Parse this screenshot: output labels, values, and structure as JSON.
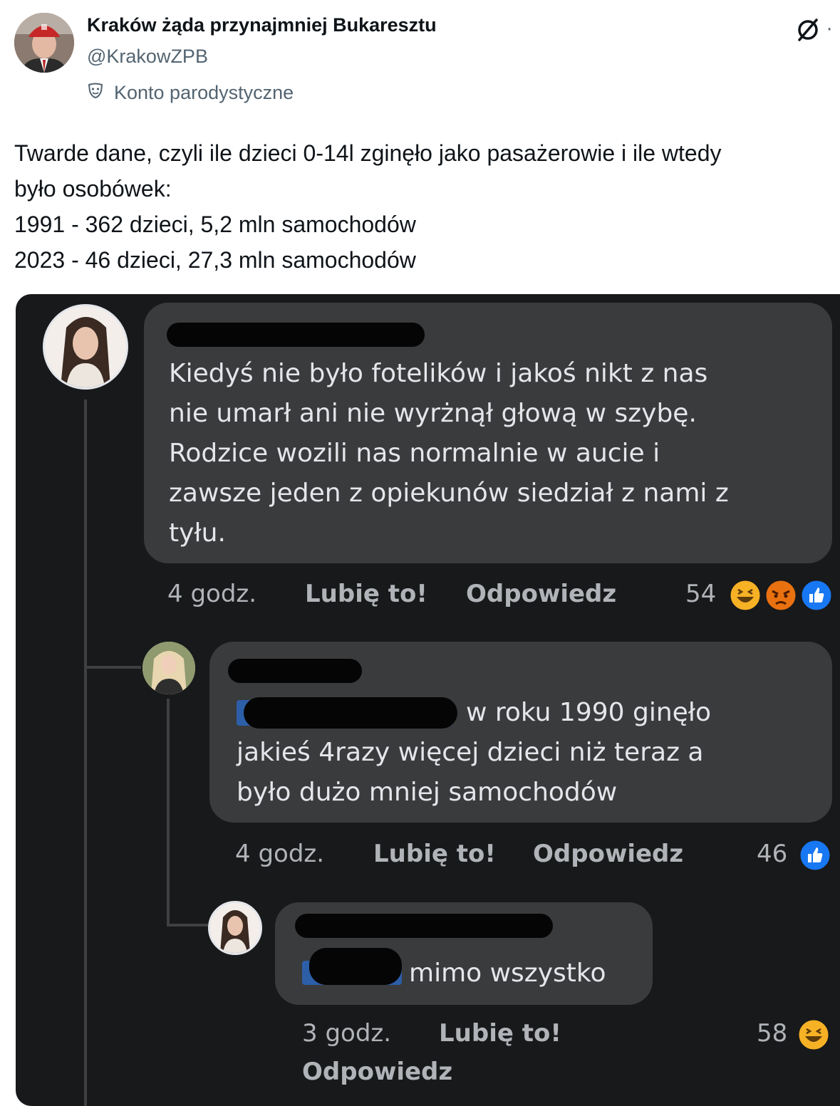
{
  "tweet": {
    "author_name": "Kraków żąda przynajmniej Bukaresztu",
    "author_handle": "@KrakowZPB",
    "parody_label": "Konto parodystyczne",
    "more_label": "·",
    "text_lines": [
      "Twarde dane, czyli ile dzieci 0-14l zginęło jako pasażerowie i ile wtedy",
      "było osobówek:",
      "1991 - 362 dzieci, 5,2 mln samochodów",
      "2023 - 46 dzieci, 27,3 mln samochodów"
    ]
  },
  "comments": [
    {
      "text_lines": [
        "Kiedyś nie było fotelików i jakoś nikt z nas",
        "nie umarł ani nie wyrżnął głową w szybę.",
        "Rodzice wozili nas normalnie w aucie i",
        "zawsze jeden z opiekunów siedział z nami z",
        "tyłu."
      ],
      "time": "4 godz.",
      "like_label": "Lubię to!",
      "reply_label": "Odpowiedz",
      "reaction_count": "54",
      "reactions": [
        "haha-icon",
        "angry-icon",
        "like-icon"
      ]
    },
    {
      "text_lines": [
        "w roku 1990 ginęło",
        "jakieś 4razy więcej dzieci niż teraz a",
        "było dużo mniej samochodów"
      ],
      "time": "4 godz.",
      "like_label": "Lubię to!",
      "reply_label": "Odpowiedz",
      "reaction_count": "46",
      "reactions": [
        "like-icon"
      ]
    },
    {
      "text_lines": [
        "mimo wszystko"
      ],
      "time": "3 godz.",
      "like_label": "Lubię to!",
      "reply_label": "Odpowiedz",
      "reaction_count": "58",
      "reactions": [
        "haha-icon"
      ]
    }
  ],
  "colors": {
    "fb_background": "#18191a",
    "bubble": "#3a3b3c",
    "like_blue": "#1877f2",
    "haha_yellow": "#f7b125",
    "angry_red": "#e9710f"
  }
}
